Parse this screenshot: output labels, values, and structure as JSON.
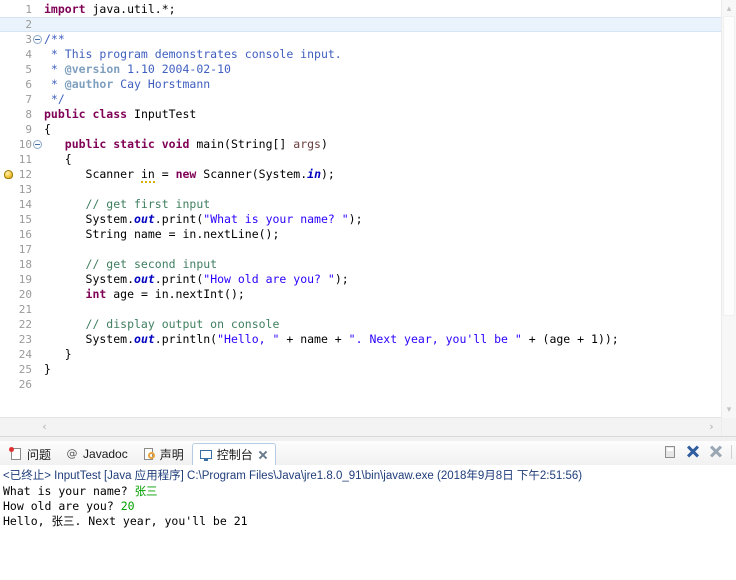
{
  "editor": {
    "current_line": 2,
    "marker_line": 12,
    "fold_lines": [
      3,
      10
    ],
    "lines": [
      {
        "n": 1,
        "tokens": [
          {
            "t": "import ",
            "c": "kw"
          },
          {
            "t": "java.util.*;",
            "c": "pln"
          }
        ]
      },
      {
        "n": 2,
        "tokens": []
      },
      {
        "n": 3,
        "tokens": [
          {
            "t": "/**",
            "c": "jdoc"
          }
        ]
      },
      {
        "n": 4,
        "tokens": [
          {
            "t": " * This program demonstrates console input.",
            "c": "jdoc"
          }
        ]
      },
      {
        "n": 5,
        "tokens": [
          {
            "t": " * ",
            "c": "jdoc"
          },
          {
            "t": "@version",
            "c": "jtag"
          },
          {
            "t": " 1.10 2004-02-10",
            "c": "jdoc"
          }
        ]
      },
      {
        "n": 6,
        "tokens": [
          {
            "t": " * ",
            "c": "jdoc"
          },
          {
            "t": "@author",
            "c": "jtag"
          },
          {
            "t": " Cay Horstmann",
            "c": "jdoc"
          }
        ]
      },
      {
        "n": 7,
        "tokens": [
          {
            "t": " */",
            "c": "jdoc"
          }
        ]
      },
      {
        "n": 8,
        "tokens": [
          {
            "t": "public class ",
            "c": "kw"
          },
          {
            "t": "InputTest",
            "c": "pln"
          }
        ]
      },
      {
        "n": 9,
        "tokens": [
          {
            "t": "{",
            "c": "pln"
          }
        ]
      },
      {
        "n": 10,
        "tokens": [
          {
            "t": "   ",
            "c": "pln"
          },
          {
            "t": "public static void ",
            "c": "kw"
          },
          {
            "t": "main(String[] ",
            "c": "pln"
          },
          {
            "t": "args",
            "c": "prm"
          },
          {
            "t": ")",
            "c": "pln"
          }
        ]
      },
      {
        "n": 11,
        "tokens": [
          {
            "t": "   {",
            "c": "pln"
          }
        ]
      },
      {
        "n": 12,
        "tokens": [
          {
            "t": "      Scanner ",
            "c": "pln"
          },
          {
            "t": "in",
            "c": "warn"
          },
          {
            "t": " = ",
            "c": "pln"
          },
          {
            "t": "new ",
            "c": "kw"
          },
          {
            "t": "Scanner(System.",
            "c": "pln"
          },
          {
            "t": "in",
            "c": "fld"
          },
          {
            "t": ");",
            "c": "pln"
          }
        ]
      },
      {
        "n": 13,
        "tokens": []
      },
      {
        "n": 14,
        "tokens": [
          {
            "t": "      // get first input",
            "c": "cmt"
          }
        ]
      },
      {
        "n": 15,
        "tokens": [
          {
            "t": "      System.",
            "c": "pln"
          },
          {
            "t": "out",
            "c": "fld"
          },
          {
            "t": ".print(",
            "c": "pln"
          },
          {
            "t": "\"What is your name? \"",
            "c": "str"
          },
          {
            "t": ");",
            "c": "pln"
          }
        ]
      },
      {
        "n": 16,
        "tokens": [
          {
            "t": "      String name = in.nextLine();",
            "c": "pln"
          }
        ]
      },
      {
        "n": 17,
        "tokens": []
      },
      {
        "n": 18,
        "tokens": [
          {
            "t": "      // get second input",
            "c": "cmt"
          }
        ]
      },
      {
        "n": 19,
        "tokens": [
          {
            "t": "      System.",
            "c": "pln"
          },
          {
            "t": "out",
            "c": "fld"
          },
          {
            "t": ".print(",
            "c": "pln"
          },
          {
            "t": "\"How old are you? \"",
            "c": "str"
          },
          {
            "t": ");",
            "c": "pln"
          }
        ]
      },
      {
        "n": 20,
        "tokens": [
          {
            "t": "      ",
            "c": "pln"
          },
          {
            "t": "int ",
            "c": "kw"
          },
          {
            "t": "age = in.nextInt();",
            "c": "pln"
          }
        ]
      },
      {
        "n": 21,
        "tokens": []
      },
      {
        "n": 22,
        "tokens": [
          {
            "t": "      // display output on console",
            "c": "cmt"
          }
        ]
      },
      {
        "n": 23,
        "tokens": [
          {
            "t": "      System.",
            "c": "pln"
          },
          {
            "t": "out",
            "c": "fld"
          },
          {
            "t": ".println(",
            "c": "pln"
          },
          {
            "t": "\"Hello, \"",
            "c": "str"
          },
          {
            "t": " + name + ",
            "c": "pln"
          },
          {
            "t": "\". Next year, you'll be \"",
            "c": "str"
          },
          {
            "t": " + (age + ",
            "c": "pln"
          },
          {
            "t": "1",
            "c": "pln"
          },
          {
            "t": "));",
            "c": "pln"
          }
        ]
      },
      {
        "n": 24,
        "tokens": [
          {
            "t": "   }",
            "c": "pln"
          }
        ]
      },
      {
        "n": 25,
        "tokens": [
          {
            "t": "}",
            "c": "pln"
          }
        ]
      },
      {
        "n": 26,
        "tokens": []
      }
    ],
    "hscroll": {
      "left_arrow": "‹",
      "right_arrow": "›"
    },
    "vscroll": {
      "up_arrow": "▴",
      "down_arrow": "▾"
    }
  },
  "console_panel": {
    "tabs": [
      {
        "label": "问题",
        "icon": "problems-icon",
        "active": false,
        "closable": false
      },
      {
        "label": "Javadoc",
        "icon": "javadoc-icon",
        "active": false,
        "closable": false,
        "glyph": "@"
      },
      {
        "label": "声明",
        "icon": "declaration-icon",
        "active": false,
        "closable": false
      },
      {
        "label": "控制台",
        "icon": "console-icon",
        "active": true,
        "closable": true
      }
    ],
    "tools": [
      {
        "name": "clear-console-button",
        "icon": "clear-icon"
      },
      {
        "name": "terminate-button",
        "icon": "terminate-x-icon"
      },
      {
        "name": "remove-all-terminated-button",
        "icon": "remove-all-x-icon"
      }
    ],
    "status_line": "<已终止> InputTest [Java 应用程序] C:\\Program Files\\Java\\jre1.8.0_91\\bin\\javaw.exe (2018年9月8日 下午2:51:56)",
    "output": [
      {
        "segments": [
          {
            "t": "What is your name? ",
            "c": "out"
          },
          {
            "t": "张三",
            "c": "in"
          }
        ]
      },
      {
        "segments": [
          {
            "t": "How old are you? ",
            "c": "out"
          },
          {
            "t": "20",
            "c": "in"
          }
        ]
      },
      {
        "segments": [
          {
            "t": "Hello, 张三. Next year, you'll be 21",
            "c": "out"
          }
        ]
      }
    ]
  },
  "colors": {
    "keyword": "#7f0055",
    "string": "#2a00ff",
    "comment": "#3f7f5f",
    "javadoc": "#3f5fbf",
    "javadoc_tag": "#7f9fbf",
    "field": "#0000c0",
    "parameter": "#6a3e3e",
    "console_input": "#00a000",
    "status_text": "#1f3d7a",
    "current_line_bg": "#eaf2fb"
  }
}
